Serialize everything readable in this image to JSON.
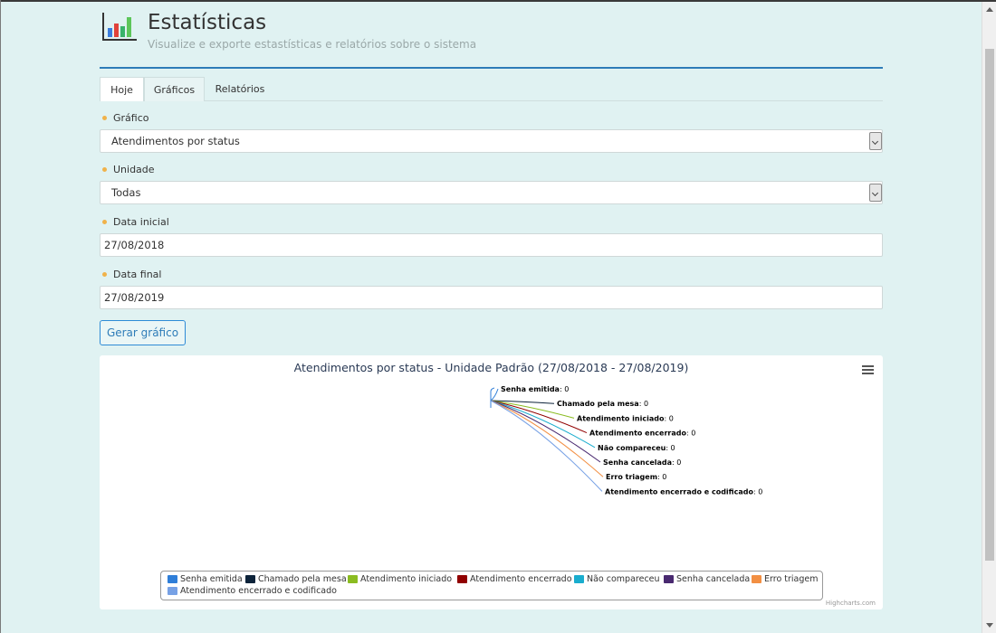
{
  "header": {
    "title": "Estatísticas",
    "subtitle": "Visualize e exporte estastísticas e relatórios sobre o sistema",
    "icon": "bar-chart-icon"
  },
  "tabs": [
    {
      "label": "Hoje"
    },
    {
      "label": "Gráficos"
    },
    {
      "label": "Relatórios"
    }
  ],
  "form": {
    "chart_label": "Gráfico",
    "chart_value": "Atendimentos por status",
    "unit_label": "Unidade",
    "unit_value": "Todas",
    "start_label": "Data inicial",
    "start_value": "27/08/2018",
    "end_label": "Data final",
    "end_value": "27/08/2019",
    "submit_label": "Gerar gráfico"
  },
  "colors": {
    "accent": "#2e7cb8",
    "required_dot": "#f0b24a",
    "background": "#e0f2f2"
  },
  "chart_data": {
    "type": "pie",
    "title": "Atendimentos por status - Unidade Padrão (27/08/2018 - 27/08/2019)",
    "credits": "Highcharts.com",
    "legend_position": "bottom",
    "series": [
      {
        "name": "Senha emitida",
        "value": 0,
        "color": "#2f7ed8"
      },
      {
        "name": "Chamado pela mesa",
        "value": 0,
        "color": "#0d233a"
      },
      {
        "name": "Atendimento iniciado",
        "value": 0,
        "color": "#8bbc21"
      },
      {
        "name": "Atendimento encerrado",
        "value": 0,
        "color": "#910000"
      },
      {
        "name": "Não compareceu",
        "value": 0,
        "color": "#1aadce"
      },
      {
        "name": "Senha cancelada",
        "value": 0,
        "color": "#492970"
      },
      {
        "name": "Erro triagem",
        "value": 0,
        "color": "#f28f43"
      },
      {
        "name": "Atendimento encerrado e codificado",
        "value": 0,
        "color": "#77a1e5"
      }
    ]
  }
}
